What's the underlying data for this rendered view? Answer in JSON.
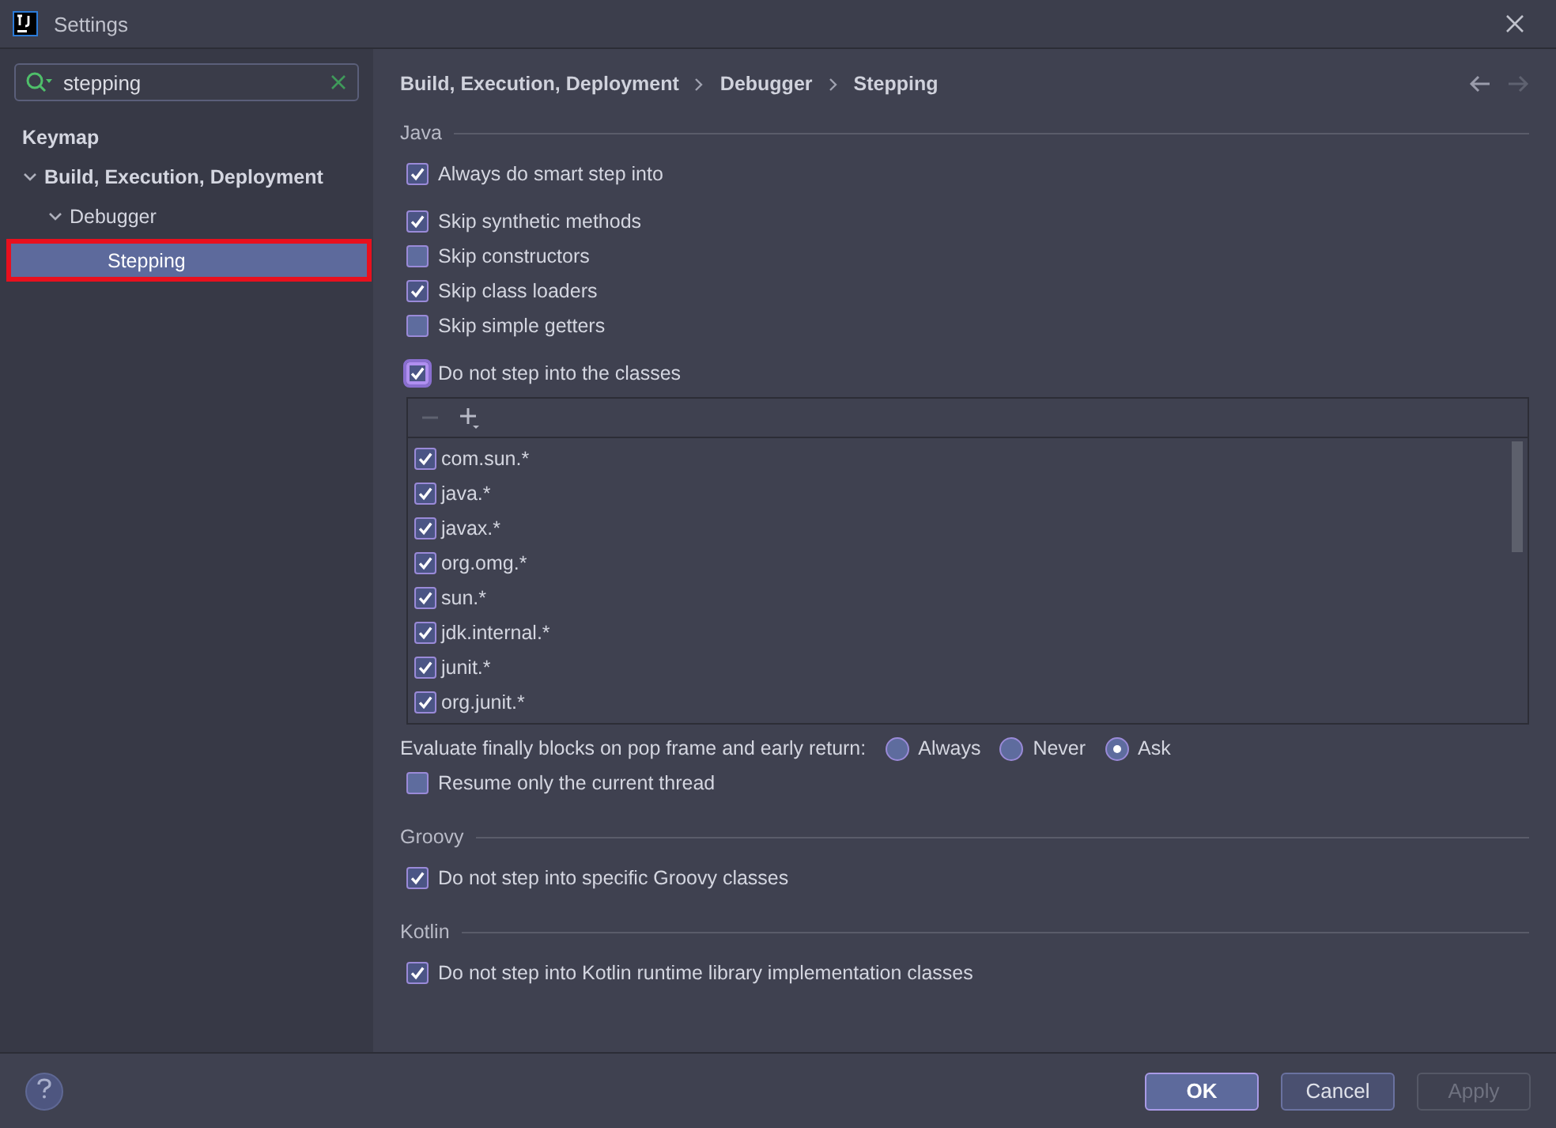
{
  "window": {
    "title": "Settings"
  },
  "search": {
    "value": "stepping"
  },
  "tree": [
    {
      "label": "Keymap",
      "selected": false
    },
    {
      "label": "Build, Execution, Deployment",
      "selected": false,
      "expanded": true,
      "children": [
        {
          "label": "Debugger",
          "selected": false,
          "expanded": true,
          "children": [
            {
              "label": "Stepping",
              "selected": true
            }
          ]
        }
      ]
    }
  ],
  "breadcrumb": [
    "Build, Execution, Deployment",
    "Debugger",
    "Stepping"
  ],
  "sections": [
    {
      "title": "Java",
      "groups": [
        [
          {
            "kind": "checkbox",
            "label": "Always do smart step into",
            "checked": true
          }
        ],
        [
          {
            "kind": "checkbox",
            "label": "Skip synthetic methods",
            "checked": true
          },
          {
            "kind": "checkbox",
            "label": "Skip constructors",
            "checked": false
          },
          {
            "kind": "checkbox",
            "label": "Skip class loaders",
            "checked": true
          },
          {
            "kind": "checkbox",
            "label": "Skip simple getters",
            "checked": false
          }
        ],
        [
          {
            "kind": "checkbox",
            "label": "Do not step into the classes",
            "checked": true,
            "focused": true
          },
          {
            "kind": "class_list",
            "entries": [
              {
                "label": "com.sun.*",
                "checked": true
              },
              {
                "label": "java.*",
                "checked": true
              },
              {
                "label": "javax.*",
                "checked": true
              },
              {
                "label": "org.omg.*",
                "checked": true
              },
              {
                "label": "sun.*",
                "checked": true
              },
              {
                "label": "jdk.internal.*",
                "checked": true
              },
              {
                "label": "junit.*",
                "checked": true
              },
              {
                "label": "org.junit.*",
                "checked": true
              }
            ]
          },
          {
            "kind": "radio_group",
            "label": "Evaluate finally blocks on pop frame and early return:",
            "options": [
              {
                "label": "Always",
                "selected": false
              },
              {
                "label": "Never",
                "selected": false
              },
              {
                "label": "Ask",
                "selected": true
              }
            ]
          },
          {
            "kind": "checkbox",
            "label": "Resume only the current thread",
            "checked": false
          }
        ]
      ]
    },
    {
      "title": "Groovy",
      "groups": [
        [
          {
            "kind": "checkbox",
            "label": "Do not step into specific Groovy classes",
            "checked": true
          }
        ]
      ]
    },
    {
      "title": "Kotlin",
      "groups": [
        [
          {
            "kind": "checkbox",
            "label": "Do not step into Kotlin runtime library implementation classes",
            "checked": true
          }
        ]
      ]
    }
  ],
  "buttons": [
    {
      "label": "OK",
      "kind": "default"
    },
    {
      "label": "Cancel",
      "kind": "normal"
    },
    {
      "label": "Apply",
      "kind": "disabled"
    }
  ]
}
